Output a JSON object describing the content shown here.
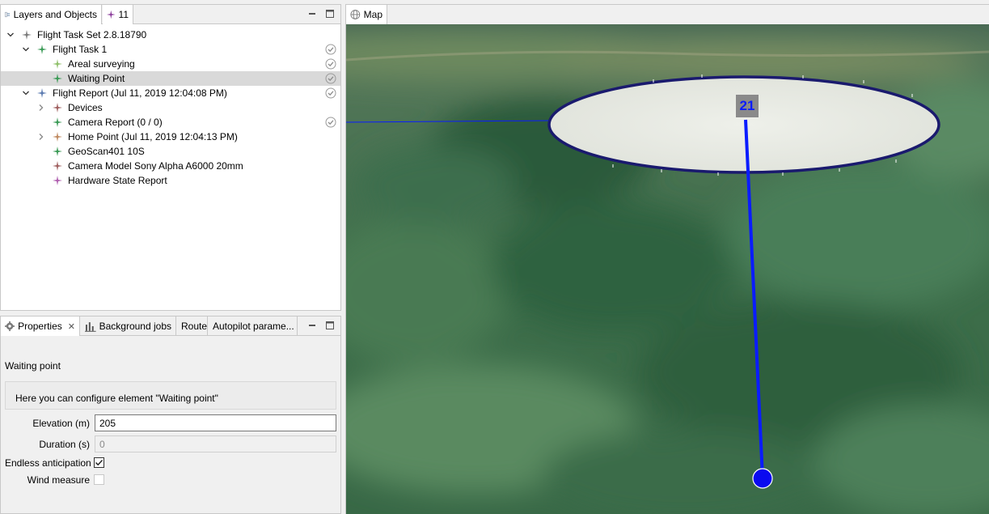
{
  "layers_panel": {
    "tabs": [
      {
        "label": "Layers and Objects",
        "icon": "layers-icon"
      },
      {
        "label": "11",
        "icon": "flight-star-icon"
      }
    ]
  },
  "tree": {
    "items": [
      {
        "label": "Flight Task Set 2.8.18790",
        "expanded": true,
        "icon_color": "#7a7a7a"
      },
      {
        "label": "Flight Task 1",
        "expanded": true,
        "icon_color": "#3a9a55"
      },
      {
        "label": "Areal surveying",
        "icon_color": "#8fc06a"
      },
      {
        "label": "Waiting Point",
        "icon_color": "#3a9a55",
        "selected": true
      },
      {
        "label": "Flight Report (Jul 11, 2019 12:04:08 PM)",
        "expanded": true,
        "icon_color": "#5a7ab0"
      },
      {
        "label": "Devices",
        "collapsed": true,
        "icon_color": "#a06060"
      },
      {
        "label": "Camera Report (0 / 0)",
        "icon_color": "#3a9a55"
      },
      {
        "label": "Home Point  (Jul 11, 2019 12:04:13 PM)",
        "collapsed": true,
        "icon_color": "#c08a60"
      },
      {
        "label": "GeoScan401 10S",
        "icon_color": "#3a9a55"
      },
      {
        "label": "Camera Model Sony Alpha A6000 20mm",
        "icon_color": "#a06060"
      },
      {
        "label": "Hardware State Report",
        "icon_color": "#b060b0"
      }
    ]
  },
  "props_panel": {
    "tabs": [
      {
        "label": "Properties",
        "icon": "gear-icon"
      },
      {
        "label": "Background jobs",
        "icon": "bar-chart-icon"
      },
      {
        "label": "Route"
      },
      {
        "label": "Autopilot parame..."
      }
    ]
  },
  "properties": {
    "section_title": "Waiting point",
    "description": "Here you can configure element \"Waiting point\"",
    "elevation_label": "Elevation (m)",
    "elevation_value": "205",
    "duration_label": "Duration (s)",
    "duration_value": "0",
    "endless_label": "Endless anticipation",
    "endless_checked": true,
    "wind_label": "Wind measure",
    "wind_checked": false
  },
  "map_panel": {
    "tab_label": "Map",
    "waypoint_number": "21",
    "route_color": "#0a1cff",
    "ring_color": "#1a1a6e"
  }
}
